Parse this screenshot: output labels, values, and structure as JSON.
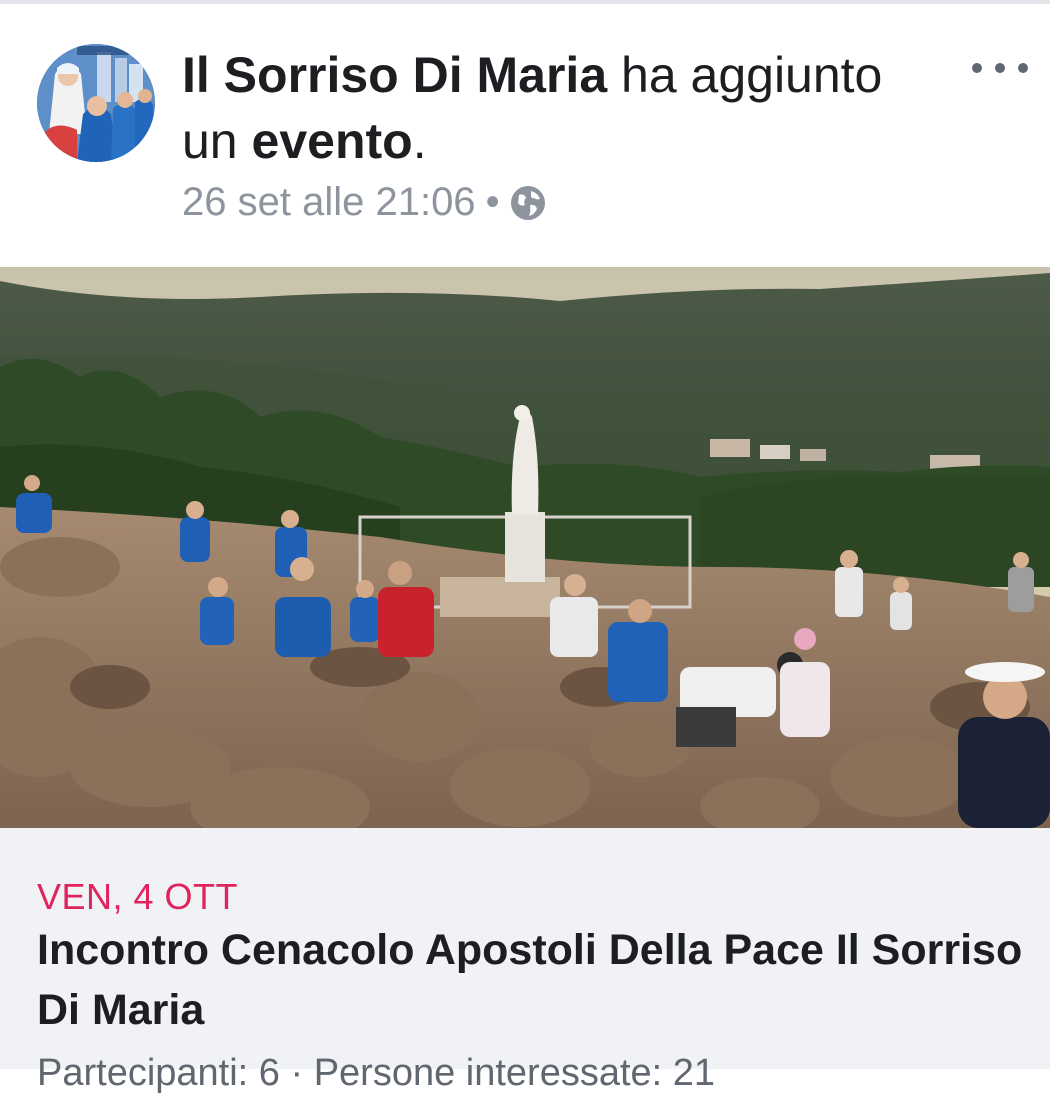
{
  "post": {
    "page_name": "Il Sorriso Di Maria",
    "action_text": " ha aggiunto",
    "action_line2_prefix": "un ",
    "action_object": "evento",
    "action_suffix": ".",
    "timestamp": "26 set alle 21:06",
    "separator": "•",
    "privacy_icon": "globe-icon",
    "more_icon": "more-options-icon",
    "avatar_caption": "Sorriso Di Maria"
  },
  "event": {
    "date": "VEN, 4 OTT",
    "title_line1": "Incontro Cenacolo Apostoli Della Pace Il Sorriso",
    "title_line2": "Di Maria",
    "subtitle": "Partecipanti: 6 · Persone interessate: 21"
  },
  "colors": {
    "date_red": "#e0245e",
    "text_dark": "#1c1e21",
    "meta_gray": "#8d949e",
    "event_bg": "#f0f2f5"
  }
}
